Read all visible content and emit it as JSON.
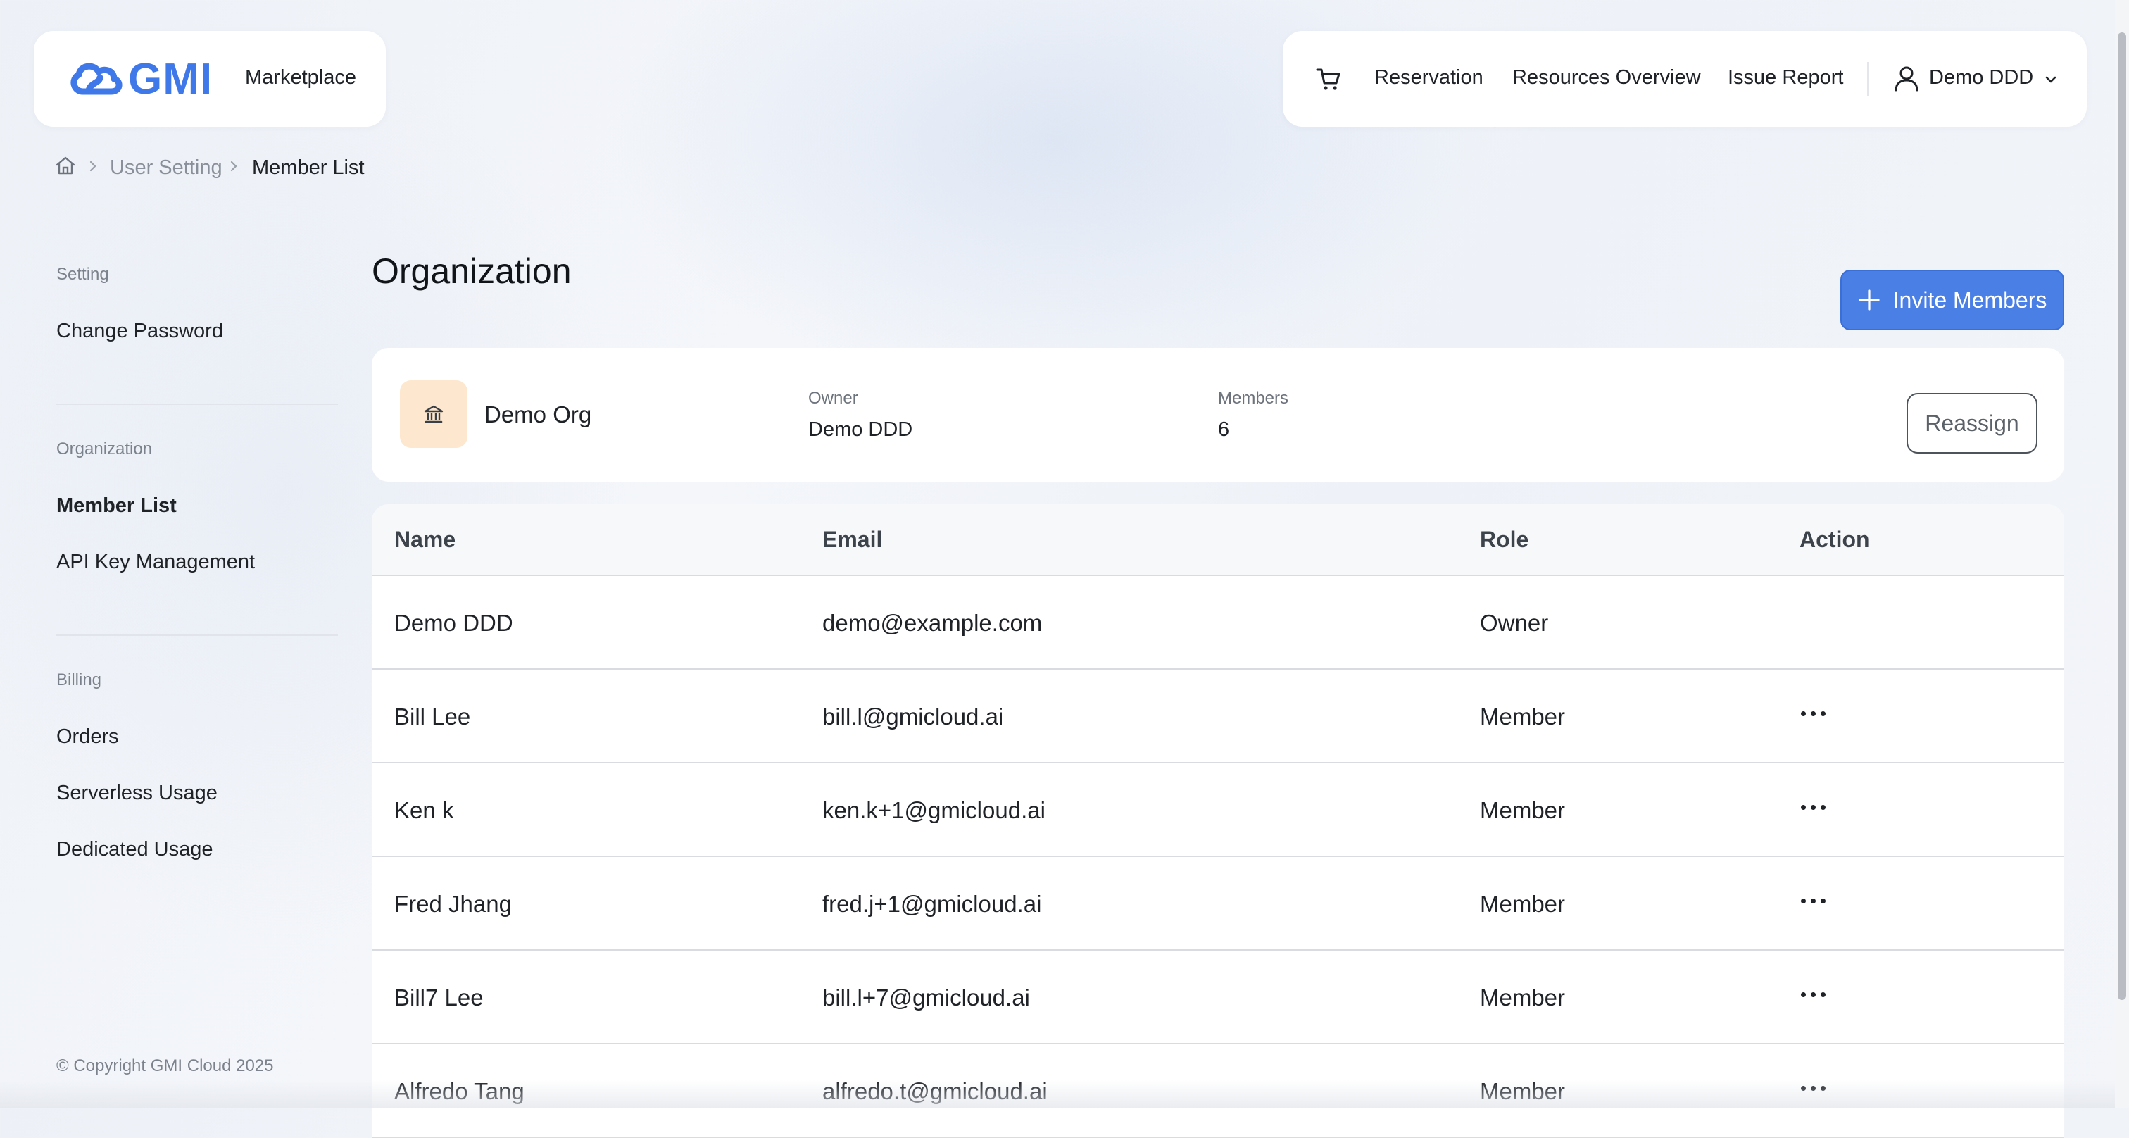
{
  "header": {
    "logo_text": "GMI",
    "brand_sub": "Marketplace",
    "nav": {
      "cart_icon": "cart-icon",
      "items": [
        "Reservation",
        "Resources Overview",
        "Issue Report"
      ],
      "user_name": "Demo DDD"
    }
  },
  "breadcrumb": {
    "home_icon": "home-icon",
    "items": [
      "User Setting",
      "Member List"
    ]
  },
  "sidebar": {
    "sections": [
      {
        "title": "Setting",
        "items": [
          "Change Password"
        ]
      },
      {
        "title": "Organization",
        "items": [
          "Member List",
          "API Key Management"
        ]
      },
      {
        "title": "Billing",
        "items": [
          "Orders",
          "Serverless Usage",
          "Dedicated Usage"
        ]
      }
    ],
    "active_item": "Member List",
    "copyright": "© Copyright GMI Cloud 2025"
  },
  "main": {
    "title": "Organization",
    "invite_label": "Invite Members",
    "org": {
      "name": "Demo Org",
      "owner_label": "Owner",
      "owner_value": "Demo DDD",
      "members_label": "Members",
      "members_value": "6",
      "reassign_label": "Reassign"
    },
    "table": {
      "headers": [
        "Name",
        "Email",
        "Role",
        "Action"
      ],
      "rows": [
        {
          "name": "Demo DDD",
          "email": "demo@example.com",
          "role": "Owner"
        },
        {
          "name": "Bill Lee",
          "email": "bill.l@gmicloud.ai",
          "role": "Member"
        },
        {
          "name": "Ken k",
          "email": "ken.k+1@gmicloud.ai",
          "role": "Member"
        },
        {
          "name": "Fred Jhang",
          "email": "fred.j+1@gmicloud.ai",
          "role": "Member"
        },
        {
          "name": "Bill7 Lee",
          "email": "bill.l+7@gmicloud.ai",
          "role": "Member"
        },
        {
          "name": "Alfredo Tang",
          "email": "alfredo.t@gmicloud.ai",
          "role": "Member"
        }
      ]
    }
  },
  "colors": {
    "accent": "#4a7fe6",
    "logo": "#3f78e8",
    "org_icon_bg": "#fde8cf"
  }
}
